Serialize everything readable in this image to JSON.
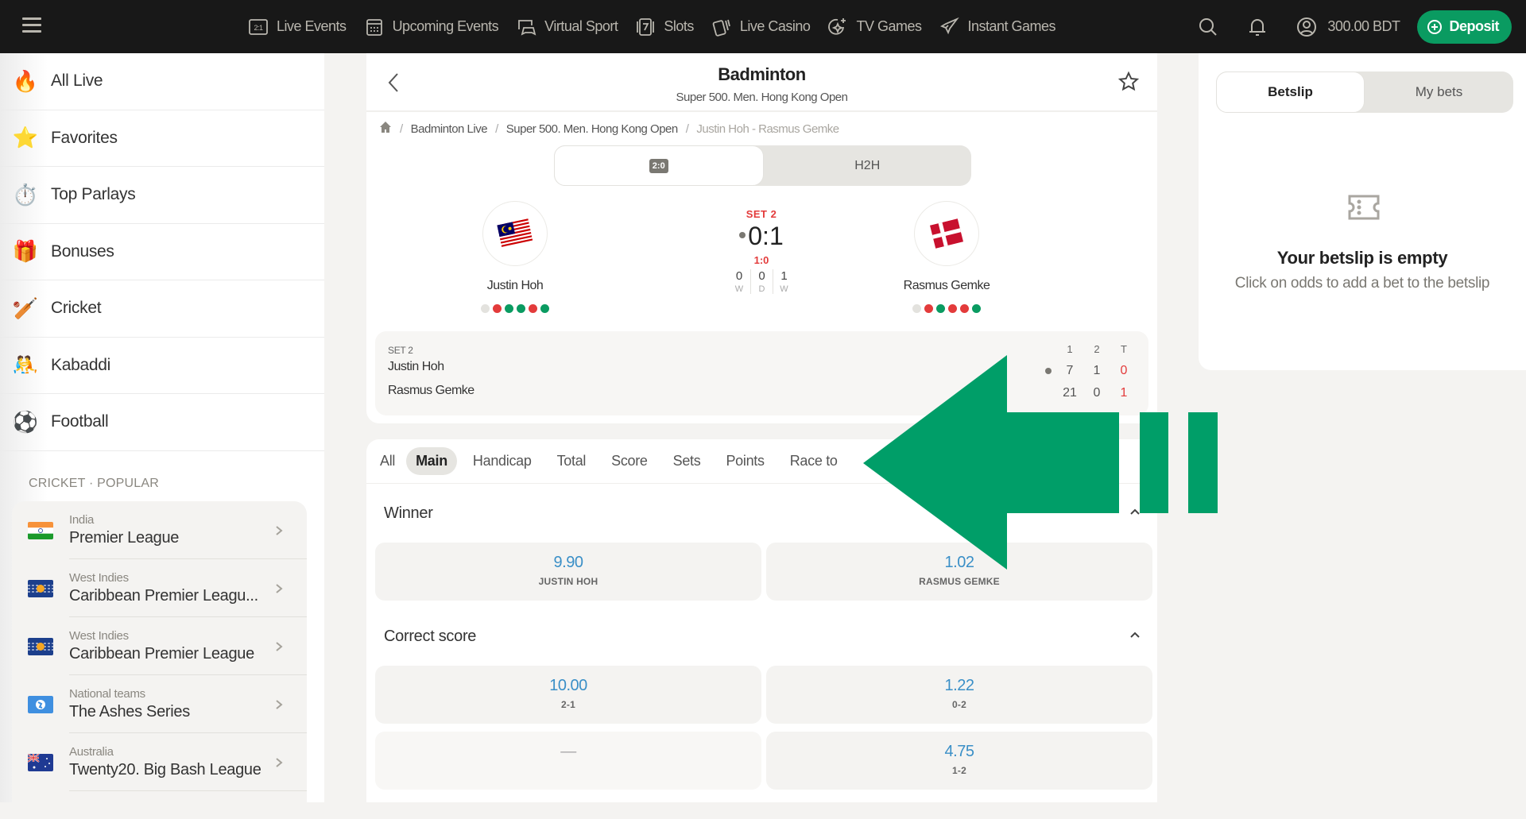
{
  "topbar": {
    "menu_icon": "hamburger-icon",
    "nav": [
      {
        "label": "Live Events",
        "icon": "live-score-icon"
      },
      {
        "label": "Upcoming Events",
        "icon": "calendar-icon"
      },
      {
        "label": "Virtual Sport",
        "icon": "gamepad-icon"
      },
      {
        "label": "Slots",
        "icon": "slot-seven-icon"
      },
      {
        "label": "Live Casino",
        "icon": "cards-icon"
      },
      {
        "label": "TV Games",
        "icon": "sparkle-icon"
      },
      {
        "label": "Instant Games",
        "icon": "rocket-icon"
      }
    ],
    "balance": "300.00 BDT",
    "deposit_label": "Deposit",
    "accent": "#0a9b61"
  },
  "sidebar": {
    "items": [
      {
        "label": "All Live",
        "icon": "fire-icon",
        "glyph": "🔥"
      },
      {
        "label": "Favorites",
        "icon": "star-icon",
        "glyph": "⭐"
      },
      {
        "label": "Top Parlays",
        "icon": "stopwatch-icon",
        "glyph": "⏱️"
      },
      {
        "label": "Bonuses",
        "icon": "gift-icon",
        "glyph": "🎁"
      },
      {
        "label": "Cricket",
        "icon": "cricket-icon",
        "glyph": "🏏"
      },
      {
        "label": "Kabaddi",
        "icon": "kabaddi-icon",
        "glyph": "🤼"
      },
      {
        "label": "Football",
        "icon": "football-icon",
        "glyph": "⚽"
      }
    ],
    "section_title": "CRICKET · POPULAR",
    "leagues": [
      {
        "country": "India",
        "name": "Premier League",
        "flag": "india"
      },
      {
        "country": "West Indies",
        "name": "Caribbean Premier Leagu...",
        "flag": "west-indies"
      },
      {
        "country": "West Indies",
        "name": "Caribbean Premier League",
        "flag": "west-indies"
      },
      {
        "country": "National teams",
        "name": "The Ashes Series",
        "flag": "globe"
      },
      {
        "country": "Australia",
        "name": "Twenty20. Big Bash League",
        "flag": "australia"
      }
    ]
  },
  "match": {
    "sport": "Badminton",
    "tournament": "Super 500. Men. Hong Kong Open",
    "breadcrumb": [
      "Badminton Live",
      "Super 500. Men. Hong Kong Open",
      "Justin Hoh - Rasmus Gemke"
    ],
    "view_tabs": [
      {
        "label": "2:0",
        "active": true
      },
      {
        "label": "H2H",
        "active": false
      }
    ],
    "home": {
      "name": "Justin Hoh",
      "flag": "malaysia",
      "form": [
        "none",
        "loss",
        "win",
        "win",
        "loss",
        "win"
      ]
    },
    "away": {
      "name": "Rasmus Gemke",
      "flag": "denmark",
      "form": [
        "none",
        "loss",
        "win",
        "loss",
        "loss",
        "win"
      ]
    },
    "period": "SET 2",
    "score": "0:1",
    "current_game": "1:0",
    "h2h": [
      {
        "n": "0",
        "l": "W"
      },
      {
        "n": "0",
        "l": "D"
      },
      {
        "n": "1",
        "l": "W"
      }
    ],
    "form_colors": {
      "win": "#0a9b61",
      "loss": "#e33b3b",
      "none": "#e3e2de"
    },
    "score_table": {
      "label": "SET 2",
      "headers": [
        "1",
        "2",
        "T"
      ],
      "rows": [
        {
          "name": "Justin Hoh",
          "serving": true,
          "values": [
            "7",
            "1",
            "0"
          ]
        },
        {
          "name": "Rasmus Gemke",
          "serving": false,
          "values": [
            "21",
            "0",
            "1"
          ]
        }
      ]
    }
  },
  "markets": {
    "tabs": [
      {
        "label": "All",
        "active": false
      },
      {
        "label": "Main",
        "active": true
      },
      {
        "label": "Handicap",
        "active": false
      },
      {
        "label": "Total",
        "active": false
      },
      {
        "label": "Score",
        "active": false
      },
      {
        "label": "Sets",
        "active": false
      },
      {
        "label": "Points",
        "active": false
      },
      {
        "label": "Race to",
        "active": false
      }
    ],
    "groups": [
      {
        "title": "Winner",
        "odds": [
          {
            "value": "9.90",
            "label": "JUSTIN HOH"
          },
          {
            "value": "1.02",
            "label": "RASMUS GEMKE"
          }
        ]
      },
      {
        "title": "Correct score",
        "odds": [
          {
            "value": "10.00",
            "label": "2-1"
          },
          {
            "value": "1.22",
            "label": "0-2"
          },
          {
            "value": "—",
            "label": "",
            "disabled": true
          },
          {
            "value": "4.75",
            "label": "1-2"
          }
        ]
      }
    ],
    "odds_color": "#3a8fc7"
  },
  "betslip": {
    "tabs": [
      {
        "label": "Betslip",
        "active": true
      },
      {
        "label": "My bets",
        "active": false
      }
    ],
    "empty_title": "Your betslip is empty",
    "empty_sub": "Click on odds to add a bet to the betslip"
  },
  "overlay": {
    "type": "left-arrow-annotation",
    "color": "#009e68"
  }
}
